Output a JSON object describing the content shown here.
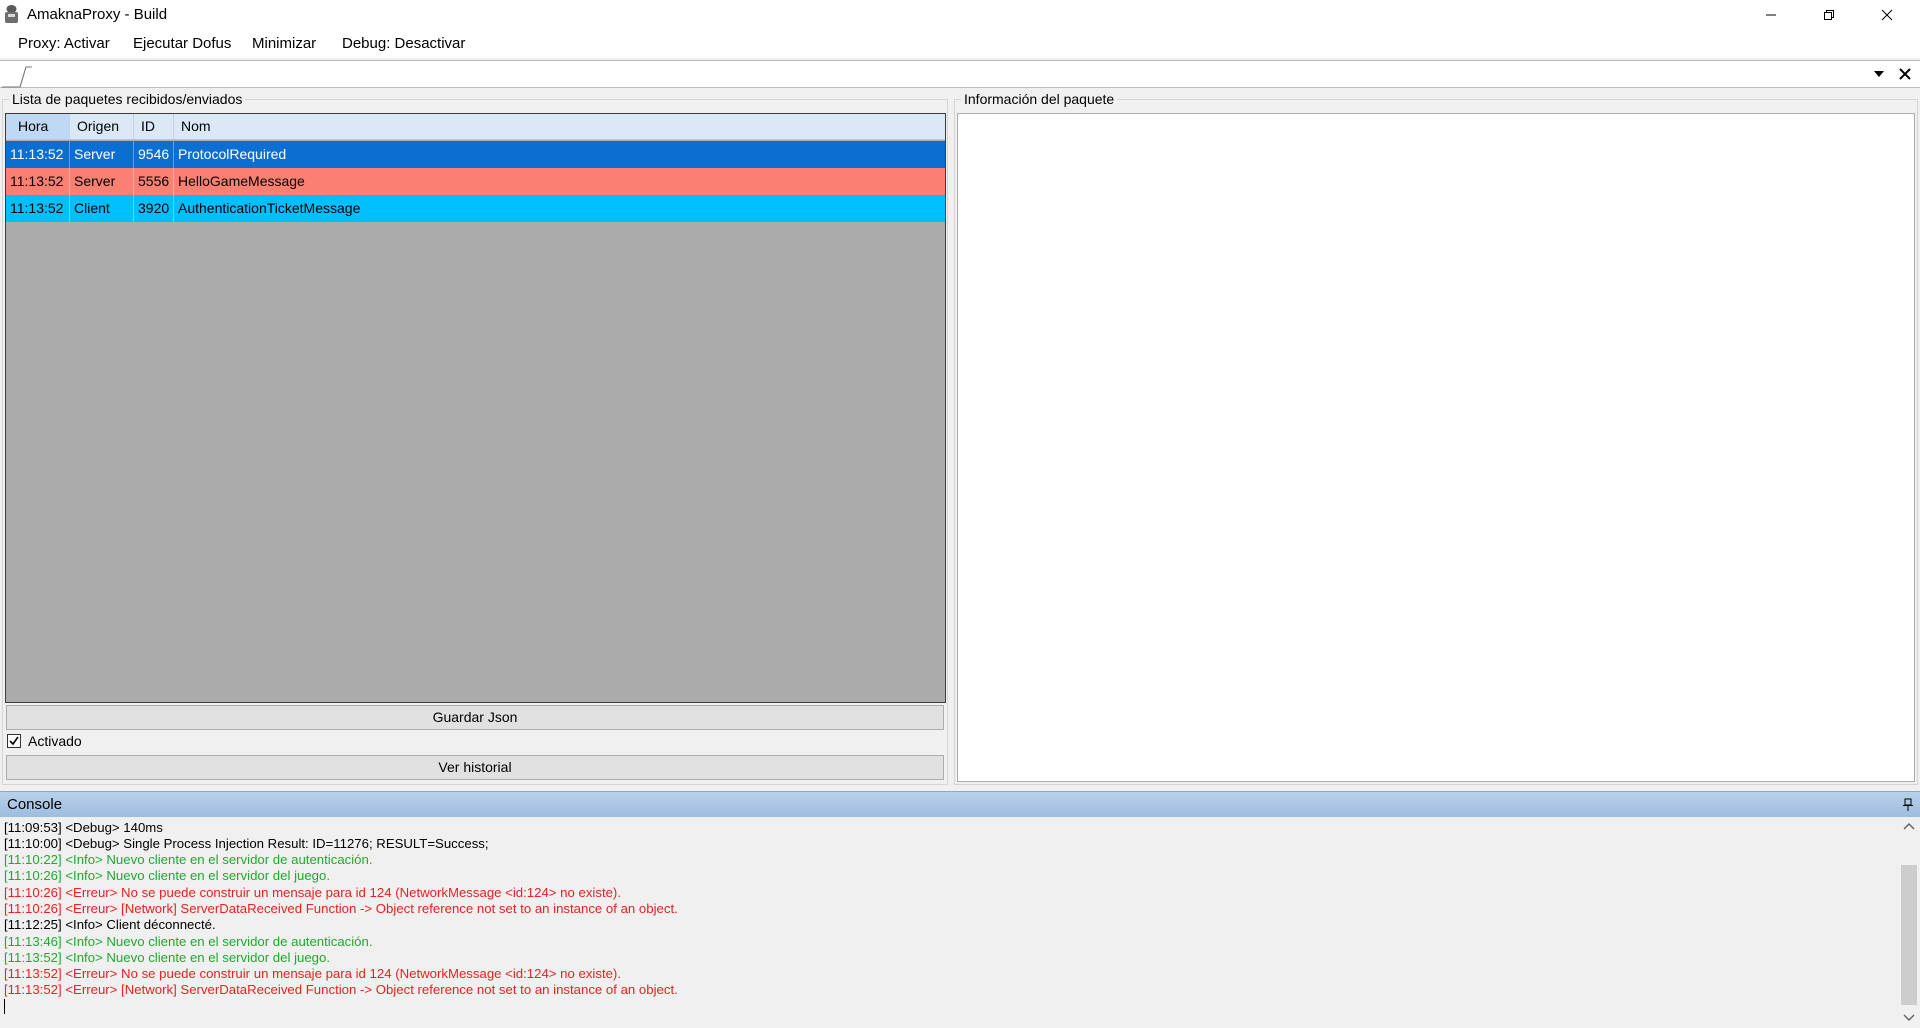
{
  "window": {
    "title": "AmaknaProxy  - Build"
  },
  "menu": {
    "items": [
      "Proxy: Activar",
      "Ejecutar Dofus",
      "Minimizar",
      "Debug: Desactivar"
    ]
  },
  "packets_panel": {
    "title": "Lista de paquetes recibidos/enviados",
    "columns": [
      "Hora",
      "Origen",
      "ID",
      "Nom"
    ],
    "rows": [
      {
        "time": "11:13:52",
        "origin": "Server",
        "id": "9546",
        "name": "ProtocolRequired",
        "color": "#0a6fd1"
      },
      {
        "time": "11:13:52",
        "origin": "Server",
        "id": "5556",
        "name": "HelloGameMessage",
        "color": "#fa8072"
      },
      {
        "time": "11:13:52",
        "origin": "Client",
        "id": "3920",
        "name": "AuthenticationTicketMessage",
        "color": "#00bfff"
      }
    ],
    "save_button": "Guardar Json",
    "checkbox_label": "Activado",
    "checkbox_checked": true,
    "history_button": "Ver historial"
  },
  "info_panel": {
    "title": "Información del paquete"
  },
  "console": {
    "title": "Console",
    "lines": [
      {
        "text": "[11:09:53] <Debug> 140ms",
        "level": "debug"
      },
      {
        "text": "[11:10:00] <Debug> Single Process Injection Result: ID=11276; RESULT=Success;",
        "level": "debug"
      },
      {
        "text": "[11:10:22] <Info> Nuevo cliente en el servidor de autenticación.",
        "level": "info"
      },
      {
        "text": "[11:10:26] <Info> Nuevo cliente en el servidor del juego.",
        "level": "info"
      },
      {
        "text": "[11:10:26] <Erreur> No se puede construir un mensaje para id 124 (NetworkMessage <id:124> no existe).",
        "level": "error"
      },
      {
        "text": "[11:10:26] <Erreur> [Network] ServerDataReceived Function -> Object reference not set to an instance of an object.",
        "level": "error"
      },
      {
        "text": "[11:12:25] <Info> Client déconnecté.",
        "level": "plain"
      },
      {
        "text": "[11:13:46] <Info> Nuevo cliente en el servidor de autenticación.",
        "level": "info"
      },
      {
        "text": "[11:13:52] <Info> Nuevo cliente en el servidor del juego.",
        "level": "info"
      },
      {
        "text": "[11:13:52] <Erreur> No se puede construir un mensaje para id 124 (NetworkMessage <id:124> no existe).",
        "level": "error"
      },
      {
        "text": "[11:13:52] <Erreur> [Network] ServerDataReceived Function -> Object reference not set to an instance of an object.",
        "level": "error"
      }
    ]
  }
}
